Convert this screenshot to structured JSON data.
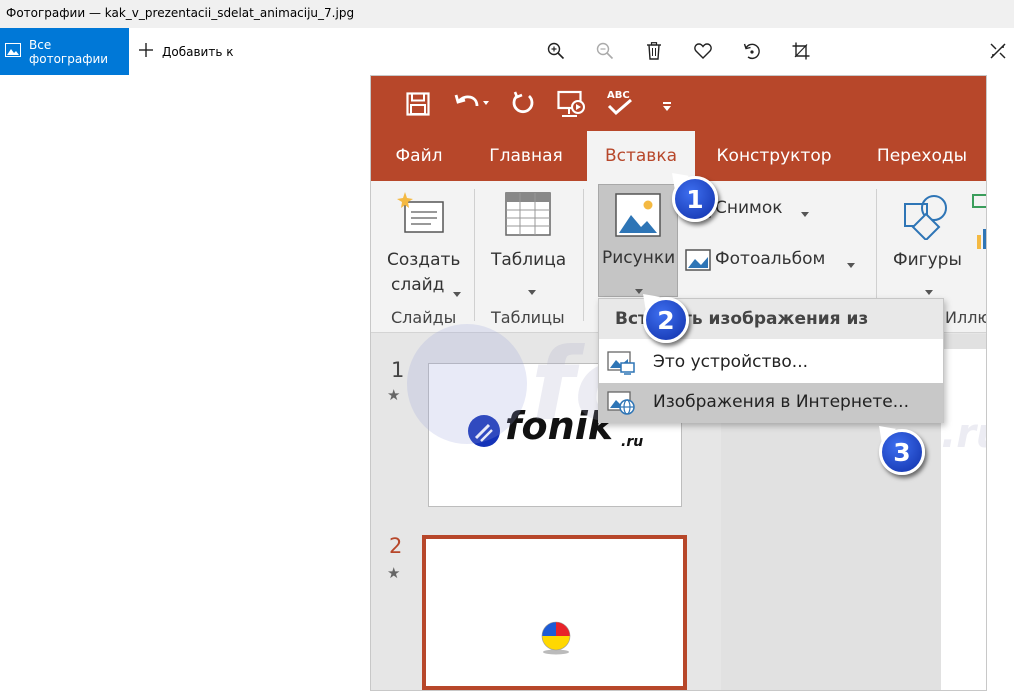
{
  "window": {
    "title": "Фотографии — kak_v_prezentacii_sdelat_animaciju_7.jpg"
  },
  "toolbar": {
    "all_photos_label": "Все фотографии",
    "add_to_label": "Добавить к",
    "tools": [
      "zoom-in-icon",
      "zoom-out-icon",
      "delete-icon",
      "favorite-icon",
      "rotate-icon",
      "crop-icon",
      "edit-icon"
    ]
  },
  "ppt": {
    "tabs": [
      "Файл",
      "Главная",
      "Вставка",
      "Конструктор",
      "Переходы"
    ],
    "active_tab": "Вставка",
    "ribbon": {
      "new_slide_line1": "Создать",
      "new_slide_line2": "слайд",
      "table_label": "Таблица",
      "pictures_label": "Рисунки",
      "screenshot_label": "Снимок",
      "photo_album_label": "Фотоальбом",
      "shapes_label": "Фигуры",
      "group_slides": "Слайды",
      "group_tables": "Таблицы",
      "group_illustrations": "Иллю"
    },
    "menu": {
      "header": "Вставить изображения из",
      "items": [
        "Это устройство...",
        "Изображения в Интернете..."
      ]
    },
    "slides": [
      {
        "number": "1",
        "logo_text": "fonik",
        "logo_suffix": ".ru"
      },
      {
        "number": "2"
      }
    ],
    "markers": [
      "1",
      "2",
      "3"
    ],
    "accent_color": "#b7472a",
    "marker_color": "#1f45c8"
  },
  "watermark": {
    "text": "fonik",
    "suffix": ".ru"
  }
}
